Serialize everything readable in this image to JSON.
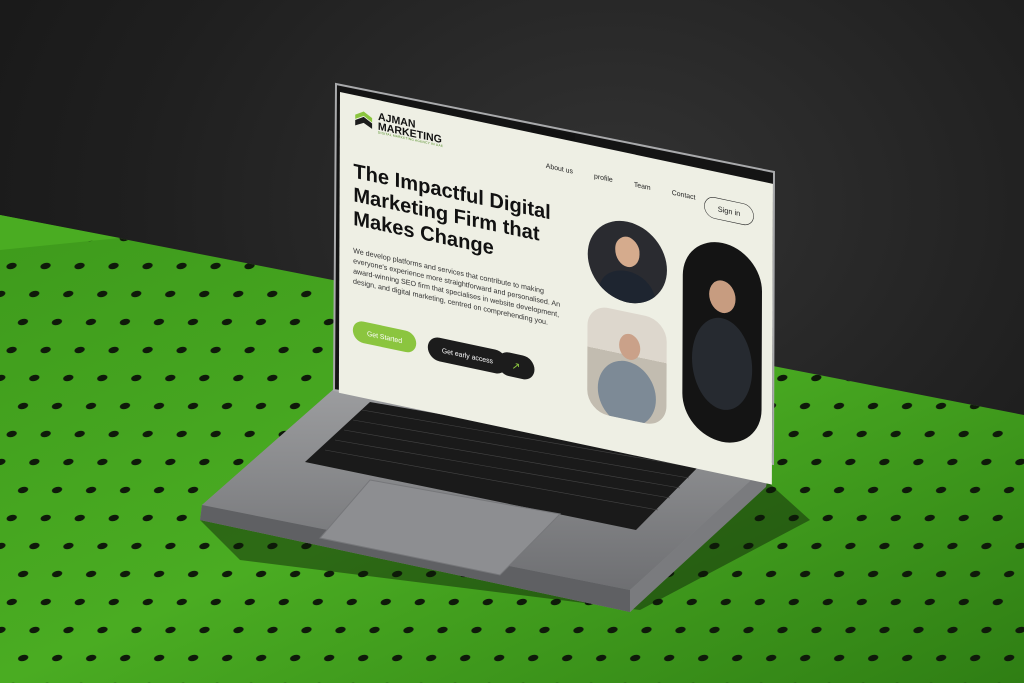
{
  "site": {
    "logo_line1": "AJMAN",
    "logo_line2": "MARKETING",
    "logo_tagline": "DIGITAL MARKETING AGENCY IN UAE",
    "nav": [
      "About us",
      "profile",
      "Team",
      "Contact"
    ],
    "signin_label": "Sign in",
    "headline": "The Impactful Digital Marketing Firm that Makes Change",
    "description": "We develop platforms and services that contribute to making everyone's experience more straightforward and personalised. An award-winning SEO firm that specialises in website development, design, and digital marketing, centred on comprehending you.",
    "cta_primary": "Get Started",
    "cta_secondary": "Get early access",
    "arrow_icon": "arrow-up-right-icon"
  },
  "colors": {
    "accent": "#8bc53f",
    "page_bg": "#eeefe4",
    "dark": "#1c1c1c",
    "floor_green": "#3f9a1e"
  }
}
